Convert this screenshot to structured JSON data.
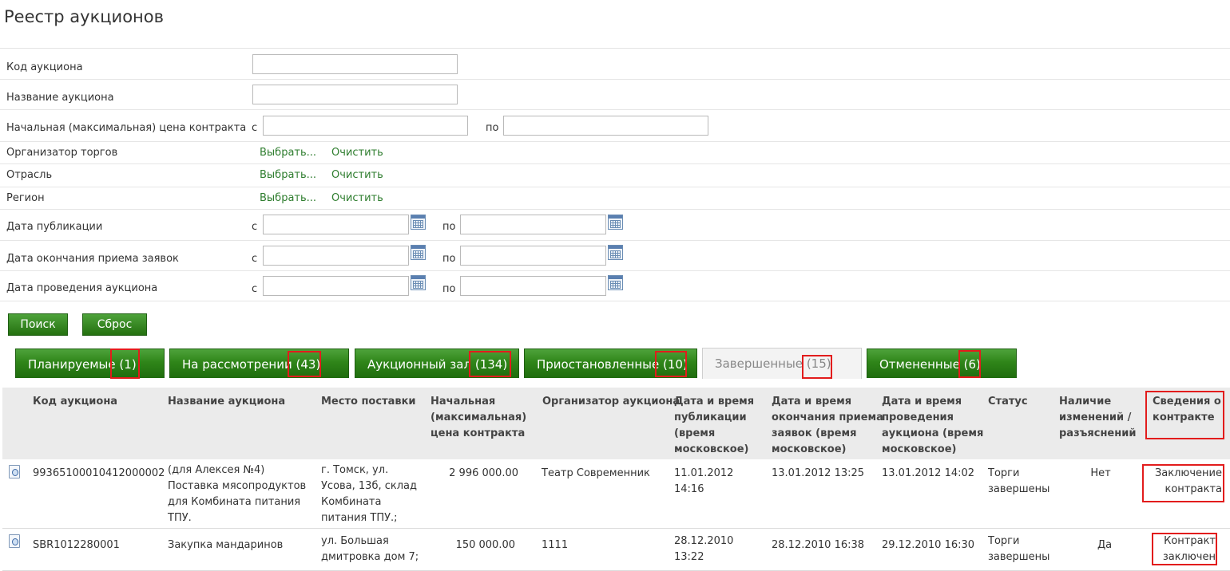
{
  "page": {
    "title": "Реестр аукционов"
  },
  "filters": {
    "auction_code": {
      "label": "Код аукциона",
      "value": ""
    },
    "auction_name": {
      "label": "Название аукциона",
      "value": ""
    },
    "price": {
      "label": "Начальная (максимальная) цена контракта",
      "from": "с",
      "to": "по",
      "from_value": "",
      "to_value": ""
    },
    "organizer": {
      "label": "Организатор торгов",
      "select": "Выбрать...",
      "clear": "Очистить"
    },
    "industry": {
      "label": "Отрасль",
      "select": "Выбрать...",
      "clear": "Очистить"
    },
    "region": {
      "label": "Регион",
      "select": "Выбрать...",
      "clear": "Очистить"
    },
    "publish_date": {
      "label": "Дата публикации",
      "from": "с",
      "to": "по"
    },
    "bid_end_date": {
      "label": "Дата окончания приема заявок",
      "from": "с",
      "to": "по"
    },
    "auction_date": {
      "label": "Дата проведения аукциона",
      "from": "с",
      "to": "по"
    }
  },
  "buttons": {
    "search": "Поиск",
    "reset": "Сброс"
  },
  "tabs": [
    {
      "label": "Планируемые",
      "count": "(1)",
      "active": false
    },
    {
      "label": "На рассмотрении",
      "count": "(43)",
      "active": false
    },
    {
      "label": "Аукционный зал",
      "count": "(134)",
      "active": false
    },
    {
      "label": "Приостановленные",
      "count": "(10)",
      "active": false
    },
    {
      "label": "Завершенные",
      "count": "(15)",
      "active": true
    },
    {
      "label": "Отмененные",
      "count": "(6)",
      "active": false
    }
  ],
  "table": {
    "headers": {
      "code": "Код аукциона",
      "name": "Название аукциона",
      "place": "Место поставки",
      "price": [
        "Начальная",
        "(максимальная)",
        "цена контракта"
      ],
      "organizer": "Организатор аукциона",
      "published": [
        "Дата и время",
        "публикации",
        "(время",
        "московское)"
      ],
      "bid_end": [
        "Дата и время",
        "окончания приема",
        "заявок (время",
        "московское)"
      ],
      "held": [
        "Дата и время",
        "проведения",
        "аукциона (время",
        "московское)"
      ],
      "status": "Статус",
      "changes": [
        "Наличие",
        "изменений /",
        "разъяснений"
      ],
      "contract": [
        "Сведения о",
        "контракте"
      ]
    },
    "rows": [
      {
        "code": "9936510001041200000 2",
        "code_display": "99365100010412000002",
        "name": [
          "(для Алексея №4)",
          "Поставка мясопродуктов",
          "для Комбината питания",
          "ТПУ."
        ],
        "place": [
          "г. Томск, ул.",
          "Усова, 13б, склад",
          "Комбината",
          "питания ТПУ.;"
        ],
        "price": "2 996 000.00",
        "organizer": "Театр Современник",
        "published": [
          "11.01.2012",
          "14:16"
        ],
        "bid_end": "13.01.2012 13:25",
        "held": "13.01.2012 14:02",
        "status": [
          "Торги",
          "завершены"
        ],
        "changes": "Нет",
        "contract": [
          "Заключение",
          "контракта"
        ]
      },
      {
        "code_display": "SBR1012280001",
        "name": [
          "Закупка мандаринов"
        ],
        "place": [
          "ул. Большая",
          "дмитровка дом 7;"
        ],
        "price": "150 000.00",
        "organizer": "1111",
        "published": [
          "28.12.2010",
          "13:22"
        ],
        "bid_end": "28.12.2010 16:38",
        "held": "29.12.2010 16:30",
        "status": [
          "Торги",
          "завершены"
        ],
        "changes": "Да",
        "contract": [
          "Контракт",
          "заключен"
        ]
      }
    ]
  },
  "colors": {
    "accent_green": "#2f8519",
    "link_green": "#2e7d2e",
    "highlight_red": "#e21c1c"
  },
  "icons": {
    "calendar": "calendar-icon",
    "document": "document-info-icon"
  }
}
